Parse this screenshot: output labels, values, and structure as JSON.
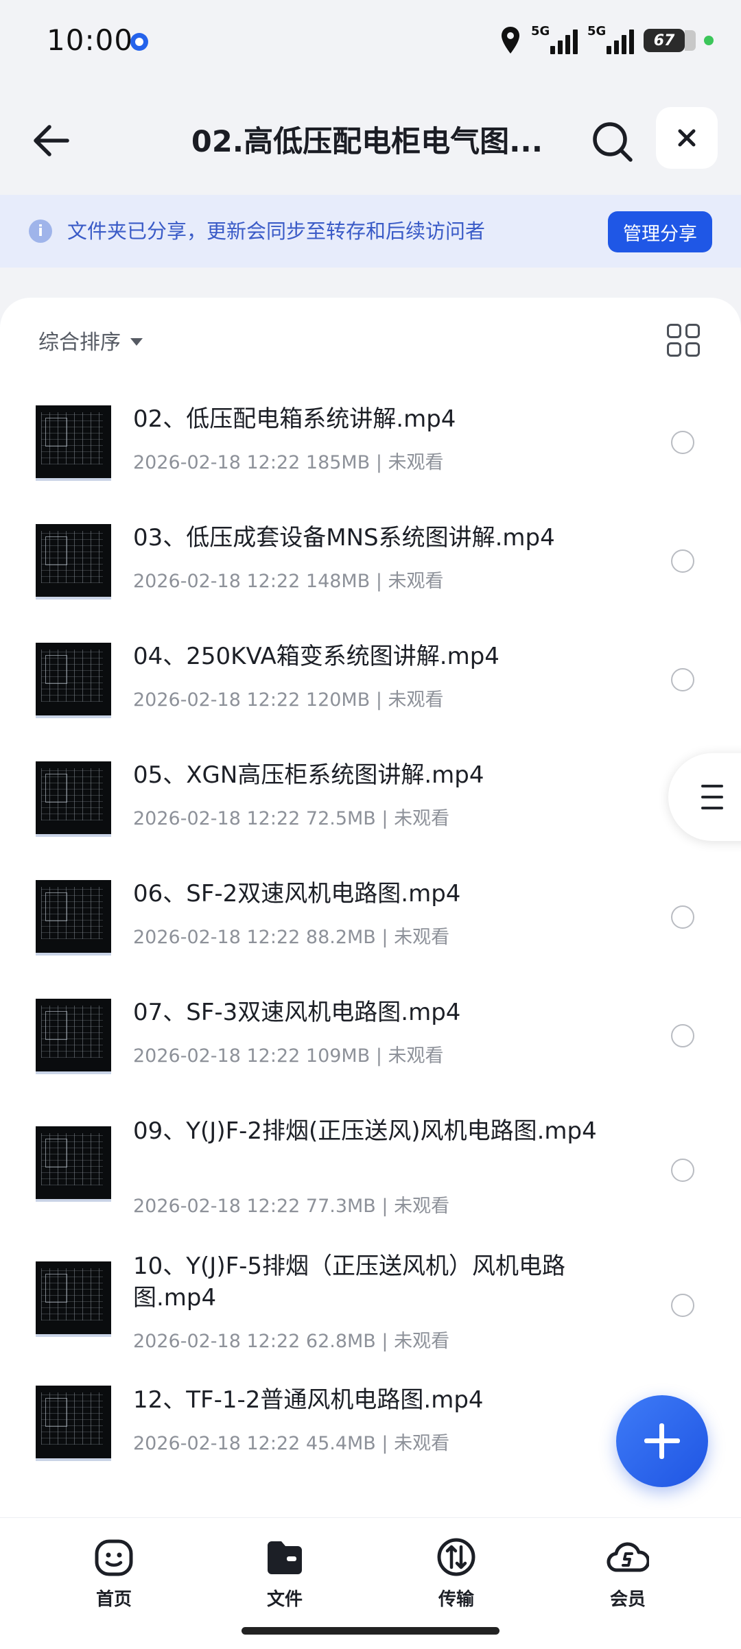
{
  "status_bar": {
    "time": "10:00",
    "network1": "5G",
    "network2": "5G",
    "battery": "67"
  },
  "header": {
    "title": "02.高低压配电柜电气图..."
  },
  "banner": {
    "text": "文件夹已分享，更新会同步至转存和后续访问者",
    "button": "管理分享"
  },
  "sort": {
    "label": "综合排序"
  },
  "files": [
    {
      "name": "02、低压配电箱系统讲解.mp4",
      "meta": "2026-02-18 12:22  185MB | 未观看"
    },
    {
      "name": "03、低压成套设备MNS系统图讲解.mp4",
      "meta": "2026-02-18 12:22  148MB | 未观看"
    },
    {
      "name": "04、250KVA箱变系统图讲解.mp4",
      "meta": "2026-02-18 12:22  120MB | 未观看"
    },
    {
      "name": "05、XGN高压柜系统图讲解.mp4",
      "meta": "2026-02-18 12:22  72.5MB | 未观看"
    },
    {
      "name": "06、SF-2双速风机电路图.mp4",
      "meta": "2026-02-18 12:22  88.2MB | 未观看"
    },
    {
      "name": "07、SF-3双速风机电路图.mp4",
      "meta": "2026-02-18 12:22  109MB | 未观看"
    },
    {
      "name": "09、Y(J)F-2排烟(正压送风)风机电路图.mp4",
      "meta": "2026-02-18 12:22  77.3MB | 未观看"
    },
    {
      "name": "10、Y(J)F-5排烟（正压送风机）风机电路图.mp4",
      "meta": "2026-02-18 12:22  62.8MB | 未观看"
    },
    {
      "name": "12、TF-1-2普通风机电路图.mp4",
      "meta": "2026-02-18 12:22  45.4MB | 未观看"
    }
  ],
  "nav": [
    {
      "label": "首页",
      "icon": "smiley-home-icon"
    },
    {
      "label": "文件",
      "icon": "folder-icon"
    },
    {
      "label": "传输",
      "icon": "transfer-icon"
    },
    {
      "label": "会员",
      "icon": "vip-cloud-icon"
    }
  ]
}
